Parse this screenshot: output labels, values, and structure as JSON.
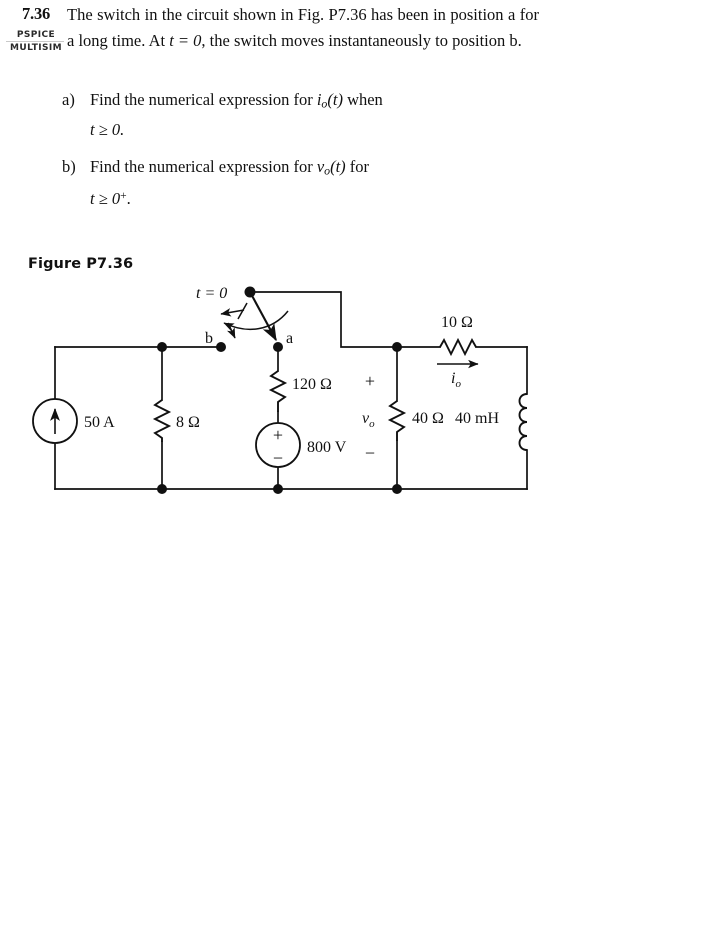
{
  "problem": {
    "number": "7.36",
    "sim_badges": [
      "PSPICE",
      "MULTISIM"
    ],
    "statement_part1": "The switch in the circuit shown in Fig. P7.36 has been in position a for a long time. At ",
    "statement_t0": "t = 0",
    "statement_part2": ", the switch moves instantaneously to position b.",
    "parts": [
      {
        "marker": "a)",
        "text_part1": "Find the numerical expression for ",
        "symbol": "i",
        "symbol_sub": "o",
        "symbol_arg": "(t)",
        "text_part2": " when",
        "condition": "t ≥ 0."
      },
      {
        "marker": "b)",
        "text_part1": "Find the numerical expression for ",
        "symbol": "v",
        "symbol_sub": "o",
        "symbol_arg": "(t)",
        "text_part2": " for",
        "condition": "t ≥ 0",
        "condition_sup": "+",
        "condition_end": "."
      }
    ]
  },
  "figure": {
    "caption": "Figure P7.36",
    "switch": {
      "time_label": "t = 0",
      "terminal_b": "b",
      "terminal_a": "a",
      "position_now": "a"
    },
    "components": [
      {
        "id": "current-source",
        "label": "50 A",
        "type": "current-source"
      },
      {
        "id": "resistor-8",
        "label": "8 Ω",
        "type": "resistor"
      },
      {
        "id": "resistor-120",
        "label": "120 Ω",
        "type": "resistor"
      },
      {
        "id": "voltage-source-800",
        "label": "800 V",
        "type": "voltage-source",
        "plus": "+",
        "minus": "−"
      },
      {
        "id": "resistor-10",
        "label": "10 Ω",
        "type": "resistor"
      },
      {
        "id": "resistor-40",
        "label": "40 Ω",
        "type": "resistor"
      },
      {
        "id": "inductor-40mh",
        "label": "40 mH",
        "type": "inductor"
      }
    ],
    "labels": {
      "current_io": "i",
      "current_io_sub": "o",
      "voltage_vo": "v",
      "voltage_vo_sub": "o",
      "vo_plus": "+",
      "vo_minus": "−"
    }
  },
  "colors": {
    "ink": "#111111",
    "paper": "#ffffff",
    "rule": "#c9c9c9"
  }
}
